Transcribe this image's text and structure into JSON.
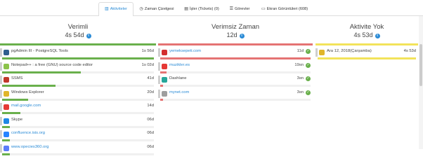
{
  "tabs": [
    {
      "label": "Aktiviteler",
      "icon": "bar-chart-icon",
      "glyph": "▥",
      "active": true
    },
    {
      "label": "Zaman Çizelgesi",
      "icon": "clock-icon",
      "glyph": "◷",
      "active": false
    },
    {
      "label": "İşler (Tickets) (0)",
      "icon": "ticket-icon",
      "glyph": "▤",
      "active": false
    },
    {
      "label": "Görevler",
      "icon": "list-icon",
      "glyph": "☰",
      "active": false
    },
    {
      "label": "Ekran Görüntüleri (608)",
      "icon": "monitor-icon",
      "glyph": "▭",
      "active": false
    }
  ],
  "columns": {
    "productive": {
      "title": "Verimli",
      "total": "4s 54d",
      "accent": "#6ab04c",
      "items": [
        {
          "name": "pgAdmin III - PostgreSQL Tools",
          "duration": "1s 56d",
          "icon": "elephant-icon",
          "color": "#2f5e8e",
          "link": false,
          "pct": 100
        },
        {
          "name": "Notepad++ : a free (GNU) source code editor",
          "duration": "1s 02d",
          "icon": "notepad-icon",
          "color": "#8bc34a",
          "link": false,
          "pct": 52
        },
        {
          "name": "SSMS",
          "duration": "41d",
          "icon": "database-icon",
          "color": "#c0392b",
          "link": false,
          "pct": 35
        },
        {
          "name": "Windows Explorer",
          "duration": "20d",
          "icon": "folder-icon",
          "color": "#e0b52a",
          "link": false,
          "pct": 17
        },
        {
          "name": "mail.google.com",
          "duration": "14d",
          "icon": "google-icon",
          "color": "#e53935",
          "link": true,
          "pct": 12
        },
        {
          "name": "Skype",
          "duration": "06d",
          "icon": "skype-icon",
          "color": "#1e88e5",
          "link": false,
          "pct": 5
        },
        {
          "name": "confluence.isis.org",
          "duration": "06d",
          "icon": "confluence-icon",
          "color": "#2684ff",
          "link": true,
          "pct": 5
        },
        {
          "name": "www.opecies360.org",
          "duration": "06d",
          "icon": "globe-icon",
          "color": "#5c7cfa",
          "link": true,
          "pct": 5
        }
      ]
    },
    "unproductive": {
      "title": "Verimsiz Zaman",
      "total": "12d",
      "accent": "#e57373",
      "items": [
        {
          "name": "yemeksepeti.com",
          "duration": "11d",
          "icon": "food-icon",
          "color": "#d32f2f",
          "link": true,
          "pct": 100
        },
        {
          "name": "muzikler.es",
          "duration": "19sn",
          "icon": "music-icon",
          "color": "#e53935",
          "link": true,
          "pct": 4
        },
        {
          "name": "Dashlane",
          "duration": "3sn",
          "icon": "shield-icon",
          "color": "#26a69a",
          "link": false,
          "pct": 2
        },
        {
          "name": "mynet.com",
          "duration": "3sn",
          "icon": "globe-icon",
          "color": "#9e9e9e",
          "link": true,
          "pct": 2
        }
      ]
    },
    "idle": {
      "title": "Aktivite Yok",
      "total": "4s 53d",
      "accent": "#f2e35a",
      "items": [
        {
          "name": "Ara 12, 2018(Çarşamba)",
          "duration": "4s 53d",
          "icon": "folder-icon",
          "color": "#e0b52a",
          "link": false,
          "pct": 100
        }
      ]
    }
  }
}
